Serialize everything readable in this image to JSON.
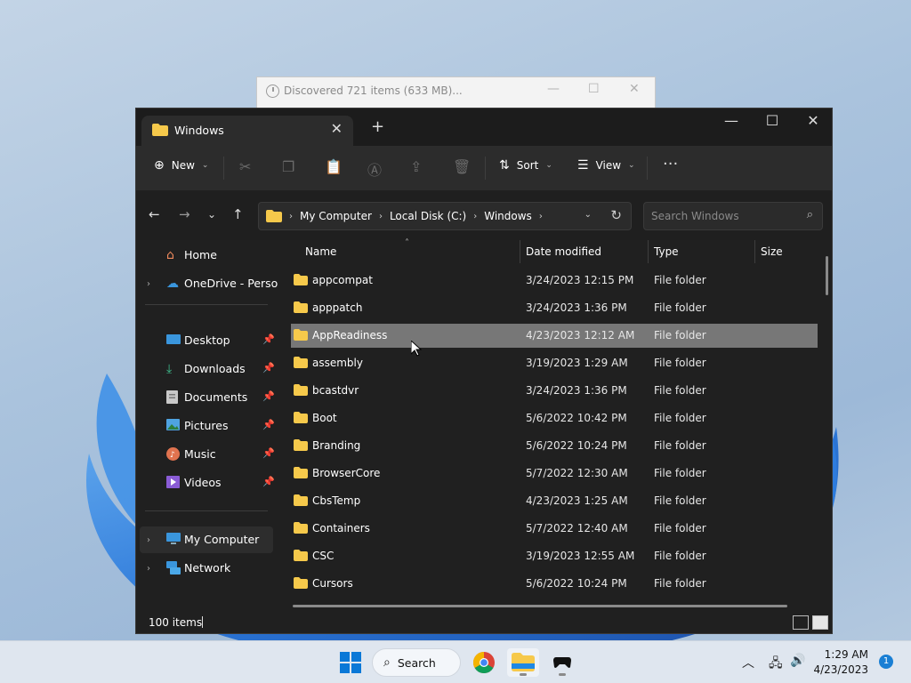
{
  "background_dialog": {
    "title": "Discovered 721 items (633 MB)..."
  },
  "window": {
    "tab_title": "Windows",
    "toolbar": {
      "new_label": "New",
      "sort_label": "Sort",
      "view_label": "View"
    },
    "address": {
      "crumbs": [
        "My Computer",
        "Local Disk (C:)",
        "Windows"
      ]
    },
    "search": {
      "placeholder": "Search Windows"
    },
    "sidebar": {
      "items": [
        {
          "label": "Home",
          "icon": "home-icon"
        },
        {
          "label": "OneDrive - Persona",
          "icon": "cloud-icon"
        },
        {
          "label": "Desktop",
          "icon": "desktop-icon"
        },
        {
          "label": "Downloads",
          "icon": "download-icon"
        },
        {
          "label": "Documents",
          "icon": "document-icon"
        },
        {
          "label": "Pictures",
          "icon": "picture-icon"
        },
        {
          "label": "Music",
          "icon": "music-icon"
        },
        {
          "label": "Videos",
          "icon": "video-icon"
        },
        {
          "label": "My Computer",
          "icon": "computer-icon"
        },
        {
          "label": "Network",
          "icon": "network-icon"
        }
      ]
    },
    "columns": {
      "name": "Name",
      "date": "Date modified",
      "type": "Type",
      "size": "Size"
    },
    "files": [
      {
        "name": "appcompat",
        "date": "3/24/2023 12:15 PM",
        "type": "File folder"
      },
      {
        "name": "apppatch",
        "date": "3/24/2023 1:36 PM",
        "type": "File folder"
      },
      {
        "name": "AppReadiness",
        "date": "4/23/2023 12:12 AM",
        "type": "File folder"
      },
      {
        "name": "assembly",
        "date": "3/19/2023 1:29 AM",
        "type": "File folder"
      },
      {
        "name": "bcastdvr",
        "date": "3/24/2023 1:36 PM",
        "type": "File folder"
      },
      {
        "name": "Boot",
        "date": "5/6/2022 10:42 PM",
        "type": "File folder"
      },
      {
        "name": "Branding",
        "date": "5/6/2022 10:24 PM",
        "type": "File folder"
      },
      {
        "name": "BrowserCore",
        "date": "5/7/2022 12:30 AM",
        "type": "File folder"
      },
      {
        "name": "CbsTemp",
        "date": "4/23/2023 1:25 AM",
        "type": "File folder"
      },
      {
        "name": "Containers",
        "date": "5/7/2022 12:40 AM",
        "type": "File folder"
      },
      {
        "name": "CSC",
        "date": "3/19/2023 12:55 AM",
        "type": "File folder"
      },
      {
        "name": "Cursors",
        "date": "5/6/2022 10:24 PM",
        "type": "File folder"
      }
    ],
    "status": {
      "item_count": "100 items"
    }
  },
  "taskbar": {
    "search_label": "Search",
    "time": "1:29 AM",
    "date": "4/23/2023",
    "notification_count": "1"
  },
  "colors": {
    "window_bg": "#202020",
    "selected_row": "#777777",
    "folder": "#f6c94b",
    "accent": "#1a7fd4"
  }
}
